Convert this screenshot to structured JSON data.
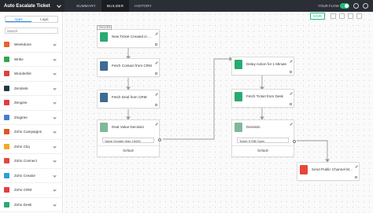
{
  "header": {
    "app_title": "Auto Escalate Ticket",
    "tabs": [
      "SUMMARY",
      "BUILDER",
      "HISTORY"
    ],
    "active_tab": "BUILDER",
    "flow_status_label": "YOUR FLOW IS",
    "flow_on": true
  },
  "sidebar": {
    "tabs": [
      "Apps",
      "Logic"
    ],
    "active_tab": "Apps",
    "search_placeholder": "Search",
    "apps": [
      {
        "name": "Weekdone",
        "color": "#e8632b"
      },
      {
        "name": "Wrike",
        "color": "#2fa84f"
      },
      {
        "name": "Wunderlist",
        "color": "#d9433a"
      },
      {
        "name": "Zendesk",
        "color": "#1f3a44"
      },
      {
        "name": "Zengine",
        "color": "#e63a3a"
      },
      {
        "name": "Zingtree",
        "color": "#4a7bd0"
      },
      {
        "name": "Zoho Campaigns",
        "color": "#e0571f"
      },
      {
        "name": "Zoho Cliq",
        "color": "#f4a922"
      },
      {
        "name": "Zoho Connect",
        "color": "#e2463f"
      },
      {
        "name": "Zoho Creator",
        "color": "#2f9edb"
      },
      {
        "name": "Zoho CRM",
        "color": "#e43e3e"
      },
      {
        "name": "Zoho Desk",
        "color": "#2aaa6f"
      }
    ]
  },
  "canvas": {
    "save_label": "SAVE",
    "nodes": {
      "trigger": {
        "tag": "TRIGGER",
        "label": "New Ticket Created in ..."
      },
      "fetch_contact": {
        "label": "Fetch Contact from CRM"
      },
      "fetch_deal": {
        "label": "Fetch Deal from CRM"
      },
      "deal_decision": {
        "label": "Deal Value Decision",
        "condition": "Value Greater than 10000",
        "default_label": "Default"
      },
      "delay": {
        "label": "Delay Action for 1 Minute"
      },
      "fetch_ticket": {
        "label": "Fetch Ticket from Desk"
      },
      "decision": {
        "label": "Decision",
        "condition": "Ticket If Still Open",
        "default_label": "Default"
      },
      "send_channel": {
        "label": "Send Public Channel M..."
      }
    }
  },
  "colors": {
    "accent": "#1fbe7a",
    "topbar": "#2b2f35",
    "crm_icon": "#3d6b93",
    "desk_icon": "#2aaa6f"
  }
}
